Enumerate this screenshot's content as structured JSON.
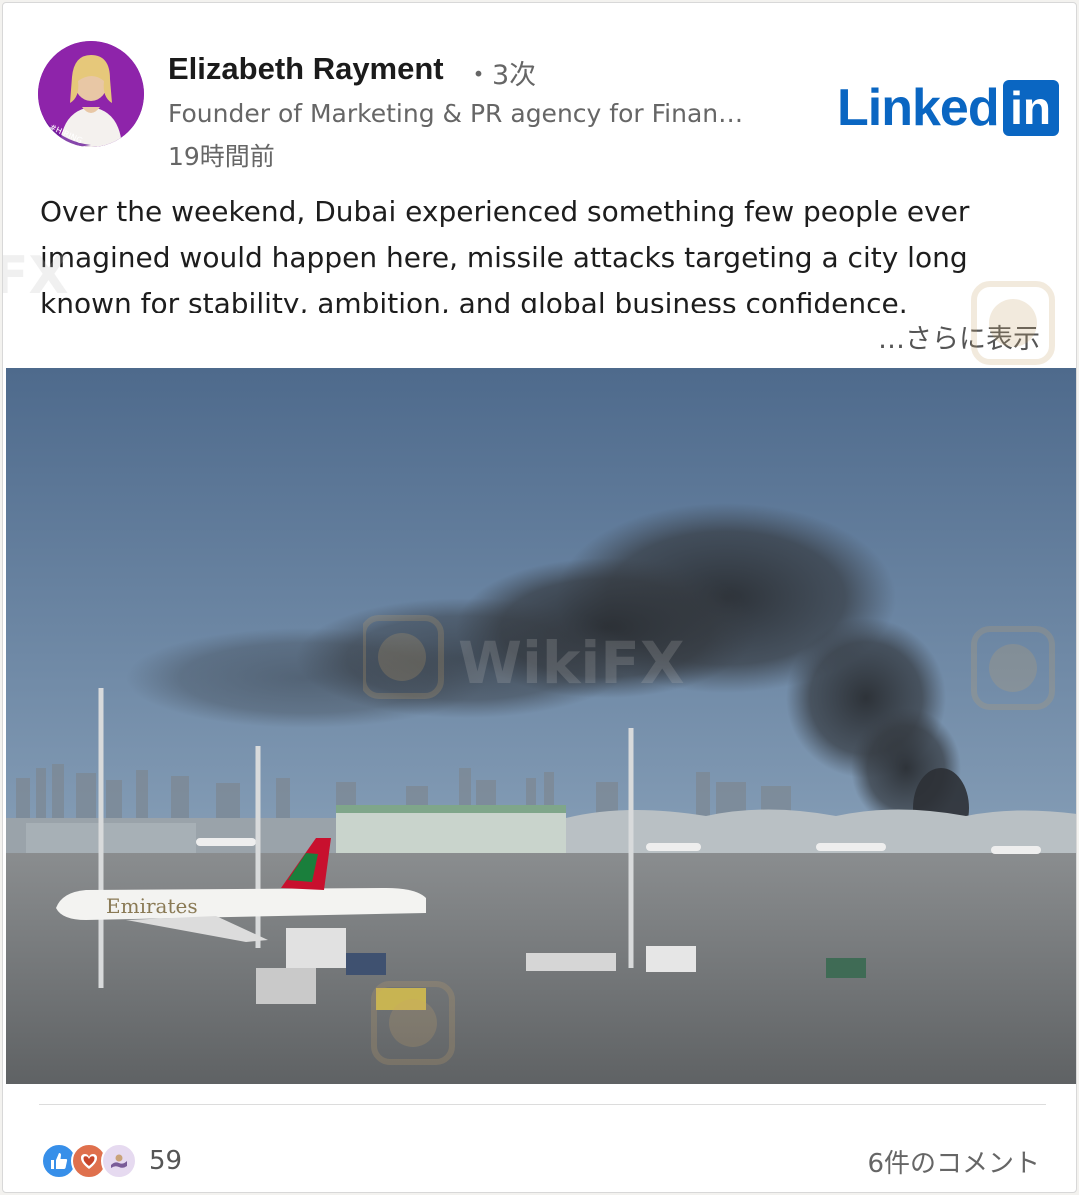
{
  "author": {
    "name": "Elizabeth Rayment",
    "degree": "・3次",
    "headline": "Founder of Marketing & PR agency for Finan…",
    "timestamp": "19時間前",
    "avatar_badge": "#HIRING"
  },
  "brand": {
    "logo_text": "Linked",
    "logo_box_text": "in",
    "color": "#0a66c2"
  },
  "post": {
    "text": "Over the weekend, Dubai experienced something few people ever imagined would happen here, missile attacks targeting a city long known for stability, ambition, and global business confidence.",
    "see_more": "…さらに表示",
    "image_airline_livery": "Emirates"
  },
  "social": {
    "reaction_icons": [
      "like-icon",
      "love-icon",
      "support-icon"
    ],
    "reaction_count": "59",
    "comments": "6件のコメント"
  },
  "watermark": {
    "text": "WikiFX"
  }
}
